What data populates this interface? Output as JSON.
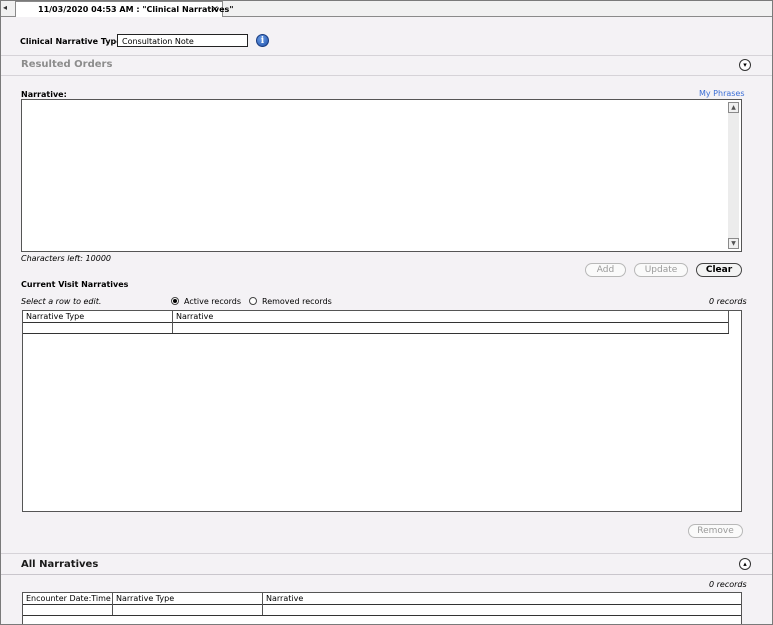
{
  "tab": {
    "title": "11/03/2020 04:53 AM : \"Clinical Narratives\"",
    "close_glyph": "×",
    "scroll_glyph": "◂"
  },
  "form": {
    "type_label": "Clinical Narrative Type",
    "type_value": "Consultation Note",
    "info_glyph": "i"
  },
  "resulted_orders": {
    "title": "Resulted Orders",
    "toggle_glyph": "▾"
  },
  "narrative": {
    "label": "Narrative:",
    "my_phrases": "My Phrases",
    "chars_left": "Characters left: 10000",
    "scroll_up": "▲",
    "scroll_down": "▼"
  },
  "buttons": {
    "add": "Add",
    "update": "Update",
    "clear": "Clear",
    "remove": "Remove"
  },
  "current_visit": {
    "title": "Current Visit Narratives",
    "hint": "Select a row to edit.",
    "active_label": "Active records",
    "removed_label": "Removed records",
    "active_selected": true,
    "count": "0 records",
    "columns": [
      "Narrative Type",
      "Narrative"
    ]
  },
  "all_narratives": {
    "title": "All Narratives",
    "toggle_glyph": "▴",
    "count": "0 records",
    "columns": [
      "Encounter Date:Time",
      "Narrative Type",
      "Narrative"
    ]
  }
}
